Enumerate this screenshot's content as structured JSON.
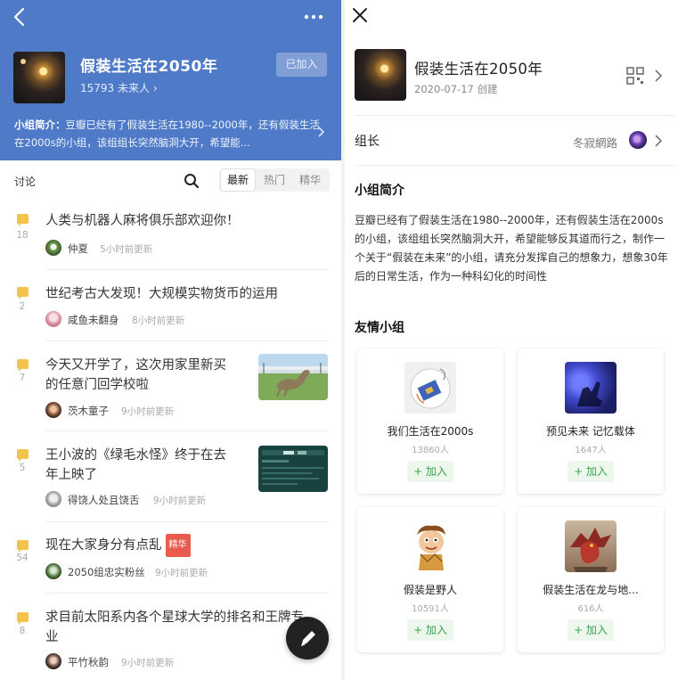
{
  "group": {
    "title": "假装生活在2050年",
    "members": "15793 未来人",
    "joined_label": "已加入",
    "intro_label": "小组简介：",
    "intro_short": "豆瓣已经有了假装生活在1980--2000年，还有假装生活在2000s的小组，该组组长突然脑洞大开，希望能..."
  },
  "tabs": {
    "discuss": "讨论",
    "segments": [
      "最新",
      "热门",
      "精华"
    ],
    "active": "最新"
  },
  "posts": [
    {
      "count": "18",
      "title": "人类与机器人麻将俱乐部欢迎你！",
      "user": "仲夏",
      "time": "5小时前更新",
      "badge": ""
    },
    {
      "count": "2",
      "title": "世纪考古大发现！大规模实物货币的运用",
      "user": "咸鱼未翻身",
      "time": "8小时前更新",
      "badge": ""
    },
    {
      "count": "7",
      "title_lines": [
        "今天又开学了，这次用家里新买",
        "的任意门回学校啦"
      ],
      "user": "茨木童子",
      "time": "9小时前更新",
      "badge": ""
    },
    {
      "count": "5",
      "title_lines": [
        "王小波的《绿毛水怪》终于在去",
        "年上映了"
      ],
      "user": "得饶人处且饶舌",
      "time": "9小时前更新",
      "badge": ""
    },
    {
      "count": "54",
      "title": "现在大家身分有点乱",
      "user": "2050组忠实粉丝",
      "time": "9小时前更新",
      "badge": "精华"
    },
    {
      "count": "8",
      "title_lines": [
        "求目前太阳系内各个星球大学的排名和王牌专",
        "业"
      ],
      "user": "平竹秋韵",
      "time": "9小时前更新",
      "badge": ""
    }
  ],
  "detail": {
    "title": "假装生活在2050年",
    "created": "2020-07-17  创建",
    "leader_label": "组长",
    "leader_name": "冬寂網路",
    "intro_heading": "小组简介",
    "intro_full": "豆瓣已经有了假装生活在1980--2000年，还有假装生活在2000s的小组，该组组长突然脑洞大开，希望能够反其道而行之，制作一个关于“假装在未来”的小组，请充分发挥自己的想象力，想象30年后的日常生活，作为一种科幻化的时间性",
    "friends_heading": "友情小组",
    "friends": [
      {
        "name": "我们生活在2000s",
        "members": "13860人",
        "join": "+ 加入"
      },
      {
        "name": "预见未来 记忆载体",
        "members": "1647人",
        "join": "+ 加入"
      },
      {
        "name": "假装是野人",
        "members": "10591人",
        "join": "+ 加入"
      },
      {
        "name": "假装生活在龙与地...",
        "members": "616人",
        "join": "+ 加入"
      }
    ]
  },
  "icons": {
    "back": "chevron-left-icon",
    "more": "more-dots-icon",
    "search": "search-icon",
    "comment": "comment-bubble-icon",
    "compose": "pencil-icon",
    "close": "close-icon",
    "qr": "qr-code-icon",
    "chevron": "chevron-right-icon"
  },
  "colors": {
    "hero_bg": "#4f7ac7",
    "bubble": "#f3c34b",
    "essence_badge": "#e85b4d",
    "join_green": "#3aa34a"
  }
}
